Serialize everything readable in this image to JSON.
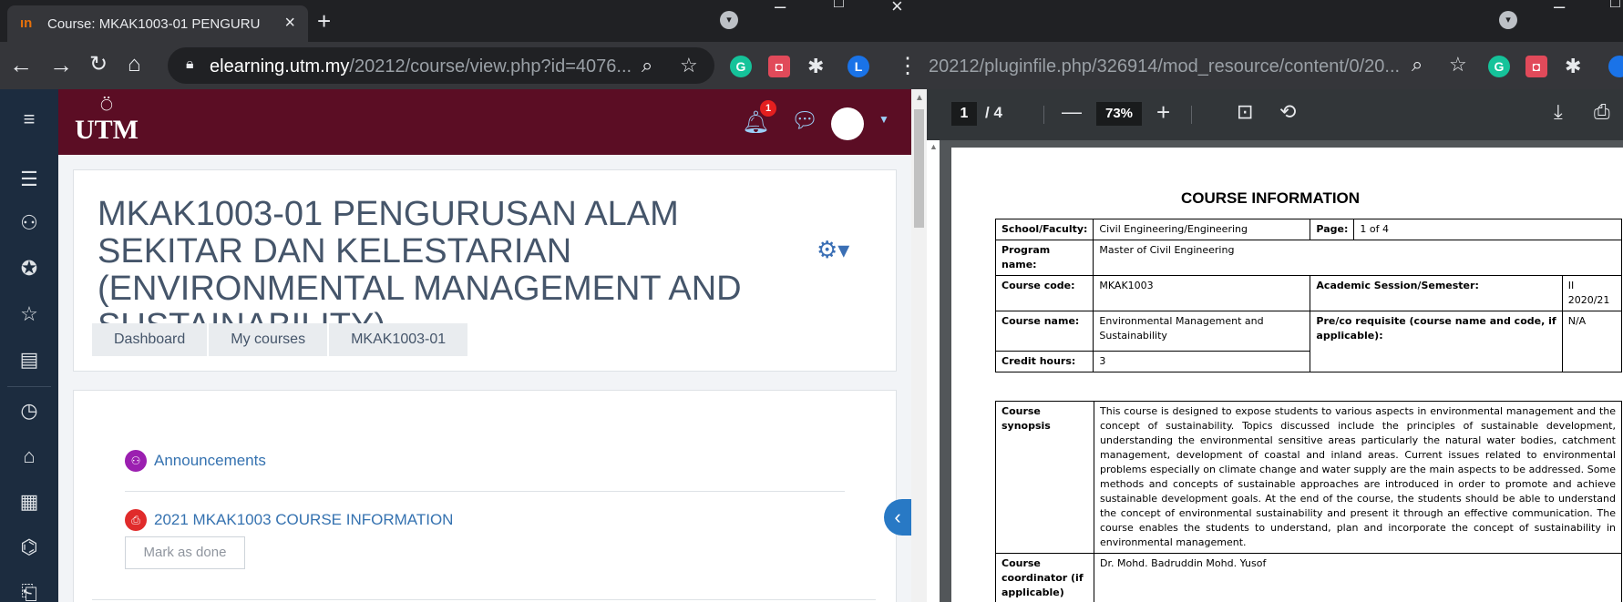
{
  "left_browser": {
    "tab": {
      "title": "Course: MKAK1003-01 PENGURU",
      "favicon": "moodle-icon"
    },
    "url_host": "elearning.utm.my",
    "url_path": "/20212/course/view.php?id=4076...",
    "extensions": [
      "G",
      "◘",
      "L"
    ]
  },
  "moodle": {
    "navbar": {
      "logo_text": "UTM",
      "notification_count": "1"
    },
    "drawer_icons": [
      "menu-icon",
      "list-icon",
      "participants-icon",
      "badges-icon",
      "competencies-icon",
      "grades-icon",
      "dashboard-icon",
      "home-icon",
      "calendar-icon",
      "courses-icon",
      "files-icon"
    ],
    "page_title": "MKAK1003-01 PENGURUSAN ALAM SEKITAR DAN KELESTARIAN (ENVIRONMENTAL MANAGEMENT AND SUSTAINABILITY)",
    "breadcrumb": [
      "Dashboard",
      "My courses",
      "MKAK1003-01"
    ],
    "activities": [
      {
        "label": "Announcements",
        "icon": "forum-icon",
        "color": "#9b1fb0"
      },
      {
        "label": "2021 MKAK1003 COURSE INFORMATION",
        "icon": "pdf-icon",
        "color": "#e02b2b"
      }
    ],
    "mark_done_label": "Mark as done"
  },
  "right_browser": {
    "url": "20212/pluginfile.php/326914/mod_resource/content/0/20...",
    "pdf": {
      "page_current": "1",
      "page_total": "/ 4",
      "zoom": "73%",
      "doc_title": "COURSE INFORMATION",
      "info": {
        "school_label": "School/Faculty:",
        "school": "Civil Engineering/Engineering",
        "page_label": "Page:",
        "page": "1 of 4",
        "program_label": "Program name:",
        "program": "Master of Civil Engineering",
        "code_label": "Course code:",
        "code": "MKAK1003",
        "session_label": "Academic Session/Semester:",
        "session": "II 2020/21",
        "name_label": "Course name:",
        "name": "Environmental Management and Sustainability",
        "prereq_label": "Pre/co requisite (course name and code, if applicable):",
        "prereq": "N/A",
        "credit_label": "Credit hours:",
        "credit": "3"
      },
      "synopsis_label": "Course synopsis",
      "synopsis": "This course is designed to expose students to various aspects in environmental management and the concept of sustainability. Topics discussed include the principles of sustainable development, understanding the environmental sensitive areas particularly the natural water bodies, catchment management, development of coastal and inland areas. Current issues related to environmental problems especially on climate change and water supply are the main aspects to be addressed. Some methods and concepts of sustainable approaches are introduced in order to promote and achieve sustainable development goals.  At the end of the course, the students should be able to understand the concept of environmental sustainability and present it through an effective communication. The course enables the students to understand, plan and incorporate the concept of sustainability in environmental management.",
      "coordinator_label": "Course coordinator (if applicable)",
      "coordinator": "Dr. Mohd. Badruddin Mohd. Yusof"
    }
  }
}
